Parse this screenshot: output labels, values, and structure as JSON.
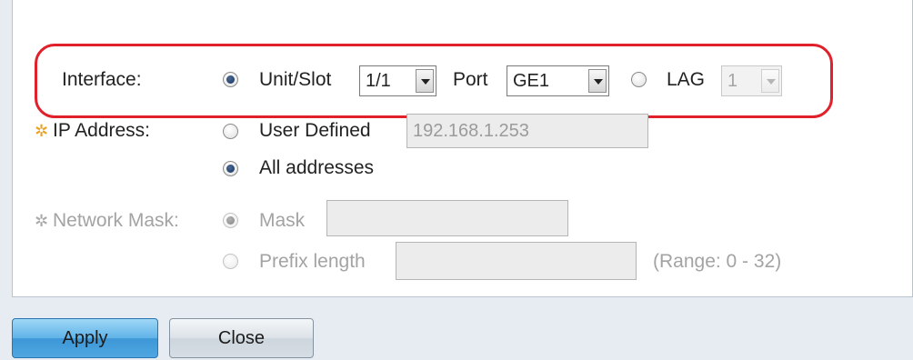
{
  "interface": {
    "label": "Interface:",
    "unit_slot_label": "Unit/Slot",
    "unit_slot_value": "1/1",
    "port_label": "Port",
    "port_value": "GE1",
    "lag_label": "LAG",
    "lag_value": "1"
  },
  "ip_address": {
    "label": "IP Address:",
    "user_defined_label": "User Defined",
    "user_defined_value": "192.168.1.253",
    "all_addresses_label": "All addresses"
  },
  "network_mask": {
    "label": "Network Mask:",
    "mask_label": "Mask",
    "mask_value": "",
    "prefix_label": "Prefix length",
    "prefix_value": "",
    "range_text": "(Range: 0 - 32)"
  },
  "buttons": {
    "apply": "Apply",
    "close": "Close"
  },
  "icons": {
    "required_gear": "gear-icon"
  },
  "colors": {
    "highlight": "#e0202a",
    "gear_active": "#e8a020",
    "gear_disabled": "#a8a8a8"
  }
}
